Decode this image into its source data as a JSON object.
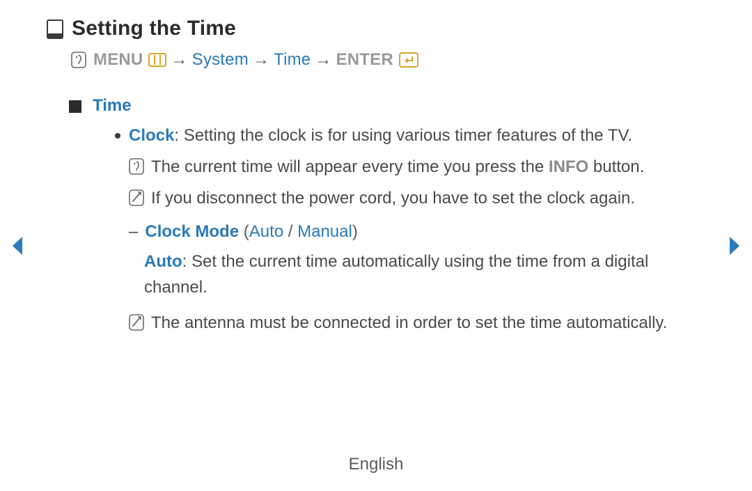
{
  "title": "Setting the Time",
  "breadcrumb": {
    "menu_label": "MENU",
    "path1": "System",
    "path2": "Time",
    "enter_label": "ENTER",
    "arrow": "→"
  },
  "section_title": "Time",
  "clock": {
    "term": "Clock",
    "desc": ": Setting the clock is for using various timer features of the TV."
  },
  "info_line": {
    "before": "The current time will appear every time you press the ",
    "info_word": "INFO",
    "after": " button."
  },
  "note1": "If you disconnect the power cord, you have to set the clock again.",
  "clock_mode": {
    "dash": "–",
    "label": "Clock Mode",
    "open": "(",
    "opt1": "Auto",
    "sep": " / ",
    "opt2": "Manual",
    "close": ")"
  },
  "auto_desc": {
    "term": "Auto",
    "text": ": Set the current time automatically using the time from a digital channel."
  },
  "note2": "The antenna must be connected in order to set the time automatically.",
  "footer_language": "English"
}
